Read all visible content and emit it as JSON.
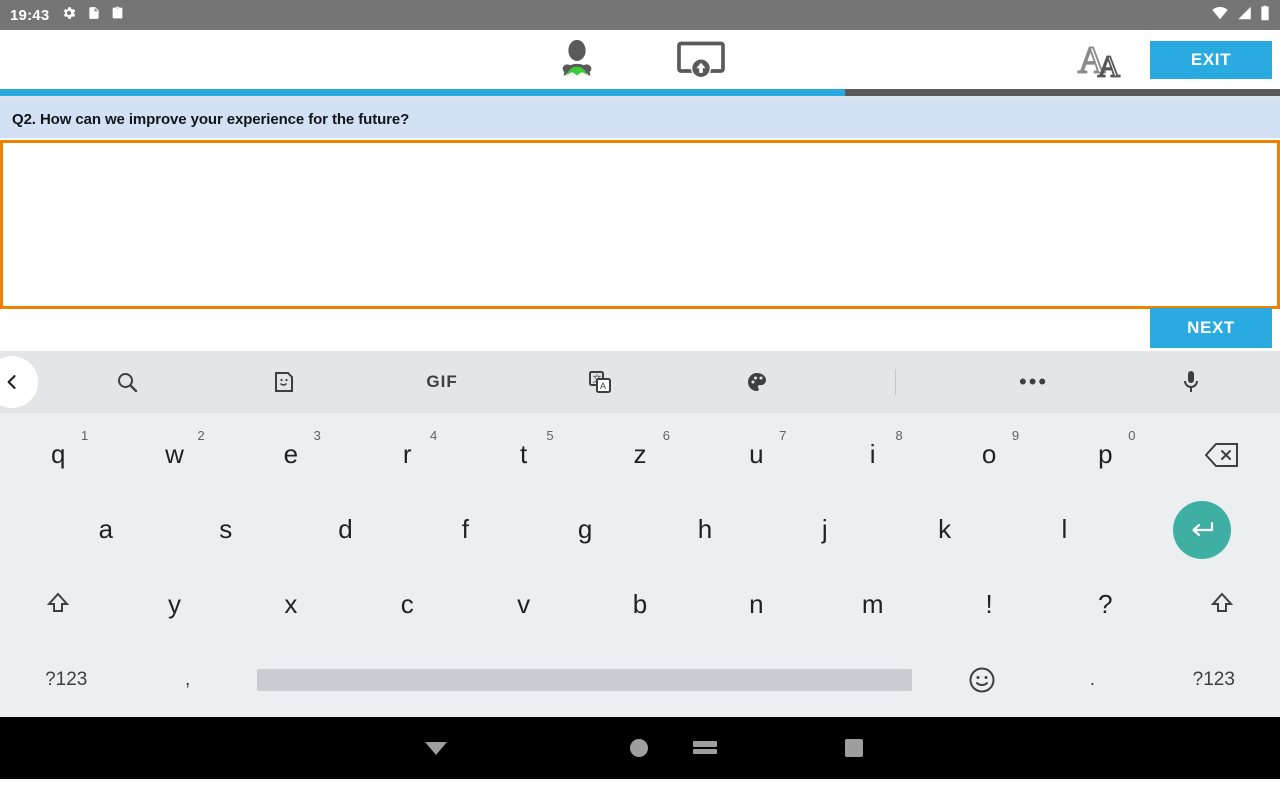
{
  "status_bar": {
    "time": "19:43",
    "left_icons": [
      "gear-icon",
      "document-icon",
      "clipboard-icon"
    ],
    "right_icons": [
      "wifi-icon",
      "signal-icon",
      "battery-icon"
    ],
    "background": "#757575"
  },
  "app_header": {
    "center_icons": [
      {
        "name": "user-profile-icon",
        "accent": "#3ACB3A"
      },
      {
        "name": "screen-upload-icon"
      }
    ],
    "font_size_icon": "font-size-aa-icon",
    "exit_label": "EXIT",
    "exit_color": "#29ABE2"
  },
  "progress": {
    "percent": 66,
    "fill_color": "#29ABE2",
    "track_color": "#5a5a5a"
  },
  "survey": {
    "question": "Q2. How can we improve your experience for the future?",
    "band_color": "#d4e1f4",
    "answer_value": "",
    "answer_placeholder": "",
    "answer_border_color": "#F08000",
    "next_label": "NEXT",
    "next_color": "#29ABE2"
  },
  "keyboard": {
    "toolbar": {
      "back_icon": "chevron-left-icon",
      "tools": [
        {
          "name": "search-icon",
          "label": ""
        },
        {
          "name": "sticker-icon",
          "label": ""
        },
        {
          "name": "gif-icon",
          "label": "GIF"
        },
        {
          "name": "translate-icon",
          "label": ""
        },
        {
          "name": "theme-palette-icon",
          "label": ""
        },
        {
          "name": "divider",
          "label": ""
        },
        {
          "name": "more-options-icon",
          "label": ""
        },
        {
          "name": "microphone-icon",
          "label": ""
        }
      ]
    },
    "row1": [
      {
        "key": "q",
        "num": "1"
      },
      {
        "key": "w",
        "num": "2"
      },
      {
        "key": "e",
        "num": "3"
      },
      {
        "key": "r",
        "num": "4"
      },
      {
        "key": "t",
        "num": "5"
      },
      {
        "key": "z",
        "num": "6"
      },
      {
        "key": "u",
        "num": "7"
      },
      {
        "key": "i",
        "num": "8"
      },
      {
        "key": "o",
        "num": "9"
      },
      {
        "key": "p",
        "num": "0"
      }
    ],
    "row1_action": "backspace-icon",
    "row2": [
      "a",
      "s",
      "d",
      "f",
      "g",
      "h",
      "j",
      "k",
      "l"
    ],
    "row2_action": "enter-icon",
    "row2_action_color": "#3FAFA3",
    "row3_shift": "shift-icon",
    "row3": [
      "y",
      "x",
      "c",
      "v",
      "b",
      "n",
      "m",
      "!",
      "?"
    ],
    "row3_shift_right": "shift-icon",
    "row4": {
      "symbols_left": "?123",
      "comma": ",",
      "space": "space-bar",
      "emoji": "emoji-icon",
      "period": ".",
      "symbols_right": "?123"
    },
    "background": "#eceff1",
    "toolbar_background": "#e3e5e8"
  },
  "nav_bar": {
    "buttons": [
      {
        "name": "back-hide-keyboard-icon"
      },
      {
        "name": "home-icon"
      },
      {
        "name": "switch-ime-icon"
      },
      {
        "name": "recents-icon"
      }
    ],
    "background": "#000000"
  }
}
